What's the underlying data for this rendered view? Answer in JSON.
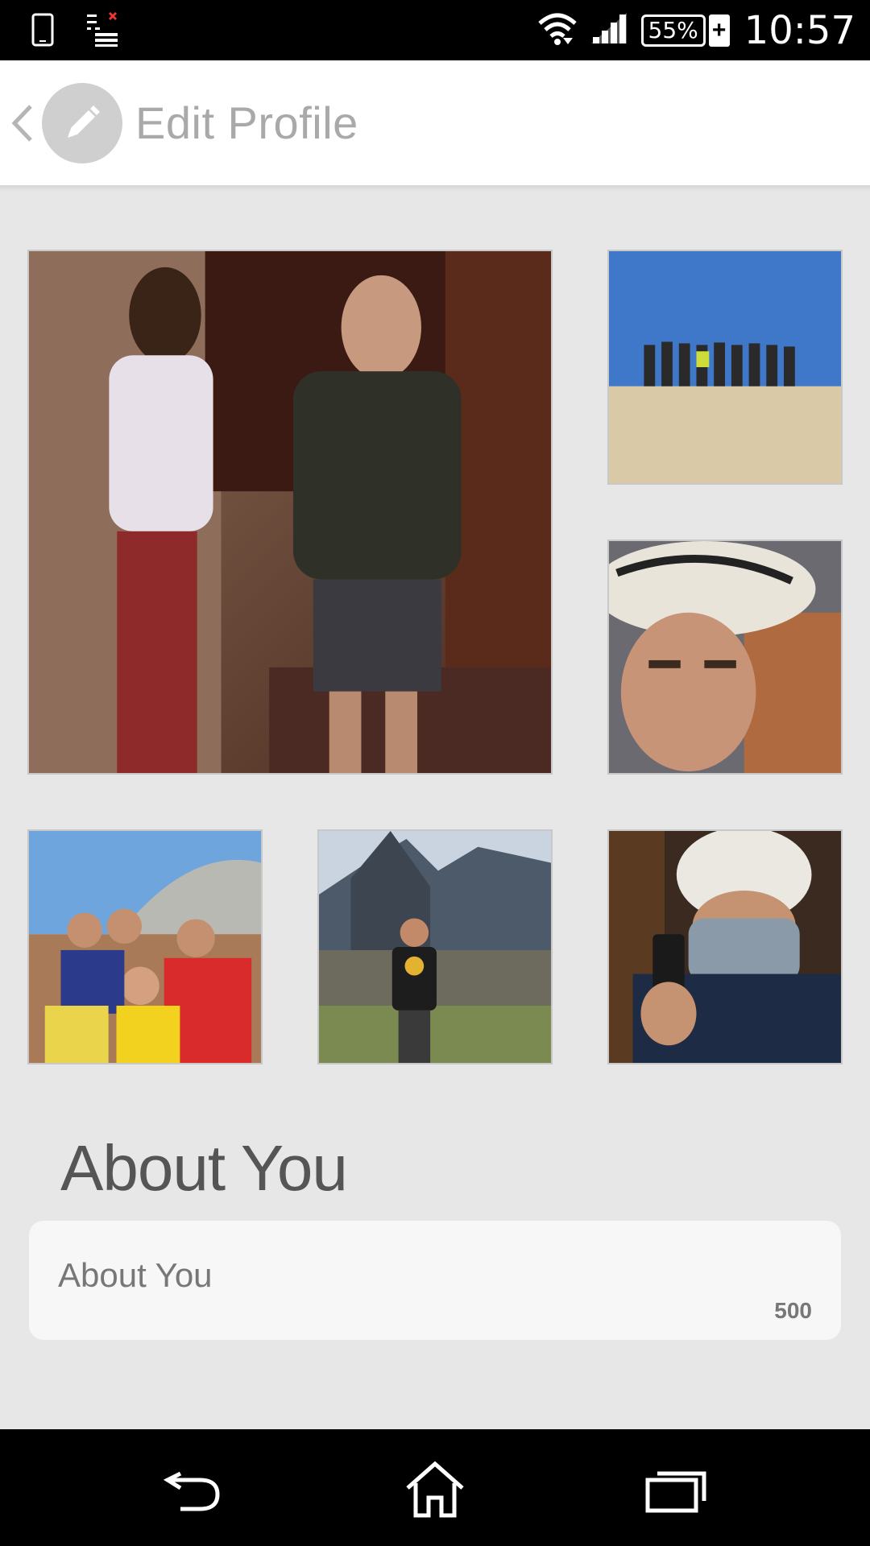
{
  "status_bar": {
    "time": "10:57",
    "battery": "55%",
    "battery_charging_symbol": "+",
    "icons": [
      "phone-icon",
      "notification-list-icon",
      "wifi-icon",
      "signal-icon",
      "battery-icon"
    ]
  },
  "app_bar": {
    "title": "Edit Profile",
    "back_icon": "chevron-left-icon",
    "app_icon": "pencil-icon"
  },
  "photos": [
    {
      "name": "photo-main"
    },
    {
      "name": "photo-2"
    },
    {
      "name": "photo-3"
    },
    {
      "name": "photo-4"
    },
    {
      "name": "photo-5"
    },
    {
      "name": "photo-6"
    }
  ],
  "about": {
    "heading": "About You",
    "placeholder": "About You",
    "char_count": "500"
  },
  "nav_bar": {
    "icons": [
      "back-icon",
      "home-icon",
      "recent-apps-icon"
    ]
  },
  "colors": {
    "background": "#e7e7e7",
    "app_bar": "#ffffff",
    "title_text": "#a9a9a9",
    "field_bg": "#f7f7f7"
  }
}
